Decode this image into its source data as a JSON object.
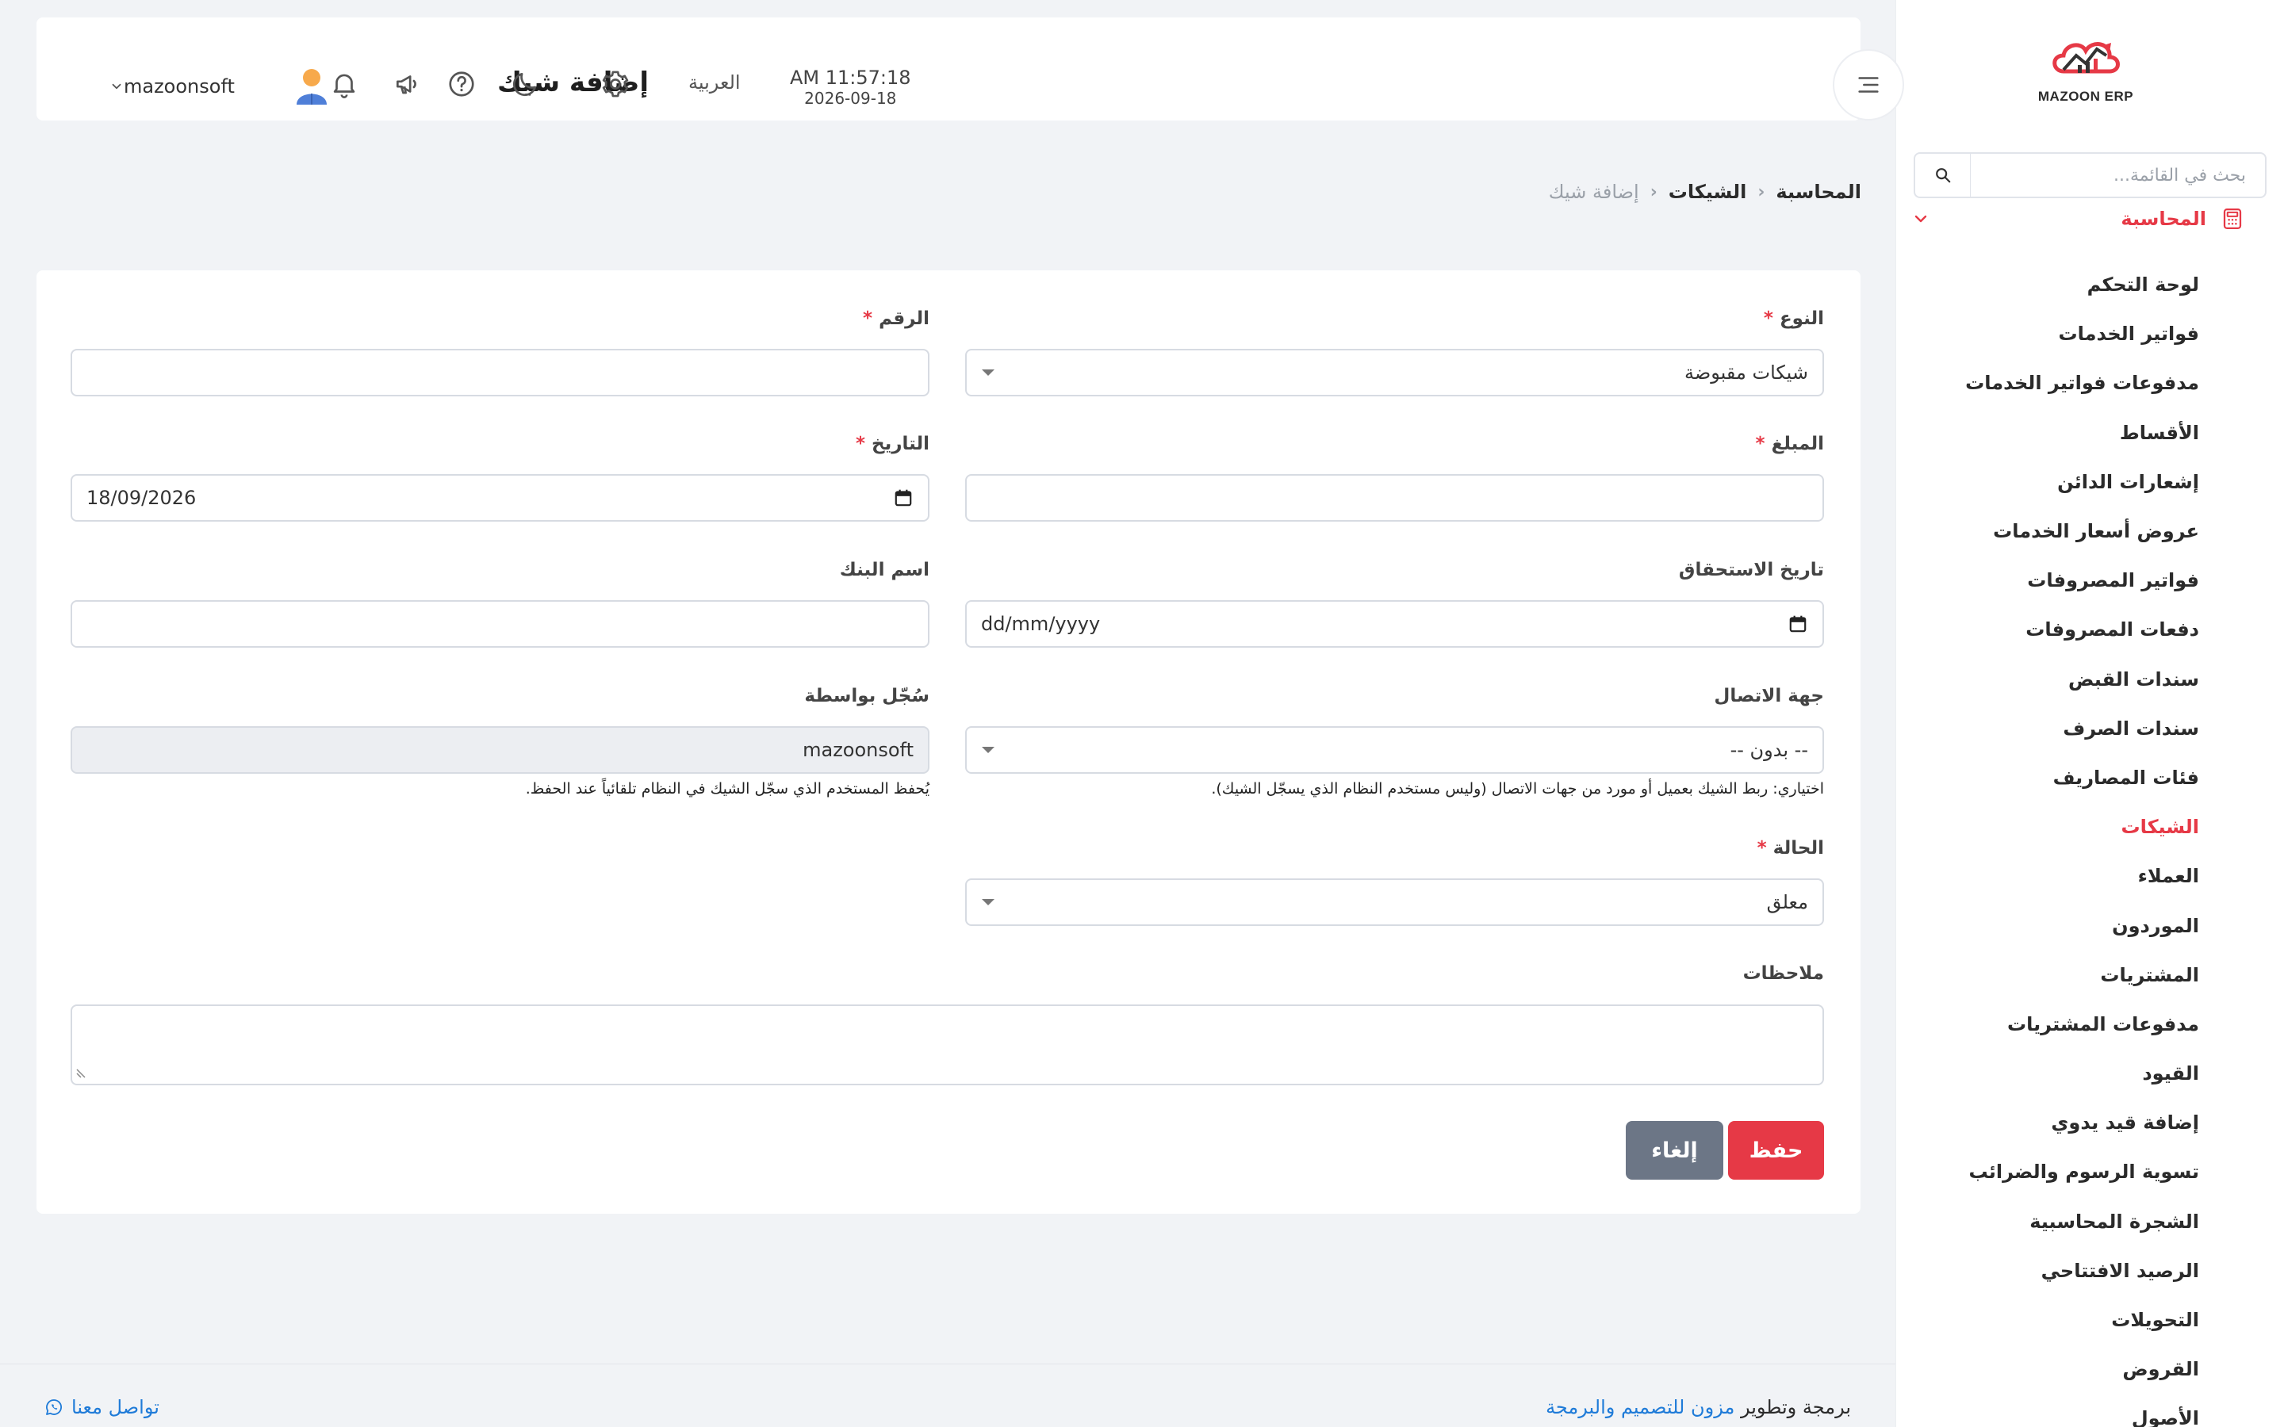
{
  "app": {
    "logo_text": "MAZOON ERP",
    "logo_small": "ERPUIB"
  },
  "sidebar": {
    "search_placeholder": "بحث في القائمة...",
    "group_label": "المحاسبة",
    "items": [
      {
        "label": "لوحة التحكم",
        "active": false
      },
      {
        "label": "فواتير الخدمات",
        "active": false
      },
      {
        "label": "مدفوعات فواتير الخدمات",
        "active": false
      },
      {
        "label": "الأقساط",
        "active": false
      },
      {
        "label": "إشعارات الدائن",
        "active": false
      },
      {
        "label": "عروض أسعار الخدمات",
        "active": false
      },
      {
        "label": "فواتير المصروفات",
        "active": false
      },
      {
        "label": "دفعات المصروفات",
        "active": false
      },
      {
        "label": "سندات القبض",
        "active": false
      },
      {
        "label": "سندات الصرف",
        "active": false
      },
      {
        "label": "فئات المصاريف",
        "active": false
      },
      {
        "label": "الشيكات",
        "active": true
      },
      {
        "label": "العملاء",
        "active": false
      },
      {
        "label": "الموردون",
        "active": false
      },
      {
        "label": "المشتريات",
        "active": false
      },
      {
        "label": "مدفوعات المشتريات",
        "active": false
      },
      {
        "label": "القيود",
        "active": false
      },
      {
        "label": "إضافة قيد يدوي",
        "active": false
      },
      {
        "label": "تسوية الرسوم والضرائب",
        "active": false
      },
      {
        "label": "الشجرة المحاسبية",
        "active": false
      },
      {
        "label": "الرصيد الافتتاحي",
        "active": false
      },
      {
        "label": "التحويلات",
        "active": false
      },
      {
        "label": "القروض",
        "active": false
      },
      {
        "label": "الأصول",
        "active": false
      }
    ]
  },
  "header": {
    "title": "إضافة شيك",
    "time": "AM 11:57:18",
    "date": "2026-09-18",
    "language": "العربية",
    "username": "mazoonsoft"
  },
  "breadcrumb": {
    "items": [
      "المحاسبة",
      "الشيكات"
    ],
    "current": "إضافة شيك"
  },
  "form": {
    "type_label": "النوع",
    "type_value": "شيكات مقبوضة",
    "number_label": "الرقم",
    "number_value": "",
    "amount_label": "المبلغ",
    "amount_value": "",
    "date_label": "التاريخ",
    "date_value": "18/09/2026",
    "due_date_label": "تاريخ الاستحقاق",
    "due_date_placeholder": "dd/mm/yyyy",
    "bank_label": "اسم البنك",
    "bank_value": "",
    "contact_label": "جهة الاتصال",
    "contact_value": "-- بدون --",
    "contact_hint": "اختياري: ربط الشيك بعميل أو مورد من جهات الاتصال (وليس مستخدم النظام الذي يسجّل الشيك).",
    "recorded_by_label": "سُجّل بواسطة",
    "recorded_by_value": "mazoonsoft",
    "recorded_by_hint": "يُحفظ المستخدم الذي سجّل الشيك في النظام تلقائياً عند الحفظ.",
    "status_label": "الحالة",
    "status_value": "معلق",
    "notes_label": "ملاحظات",
    "notes_value": "",
    "required_mark": "*",
    "save_label": "حفظ",
    "cancel_label": "إلغاء"
  },
  "footer": {
    "credit_prefix": "برمجة وتطوير",
    "credit_link": "مزون للتصميم والبرمجة",
    "contact": "تواصل معنا"
  },
  "colors": {
    "accent": "#e63946",
    "cancel": "#6c7686",
    "link": "#1f7bd8",
    "background": "#f1f3f6"
  },
  "icons": {
    "search": "search-icon",
    "calculator": "calculator-icon",
    "chevron": "chevron-down-icon",
    "menu": "menu-toggle-icon",
    "settings": "gear-icon",
    "theme": "moon-icon",
    "help": "help-icon",
    "announcements": "megaphone-icon",
    "notifications": "bell-icon",
    "calendar": "calendar-icon",
    "whatsapp": "whatsapp-icon"
  }
}
